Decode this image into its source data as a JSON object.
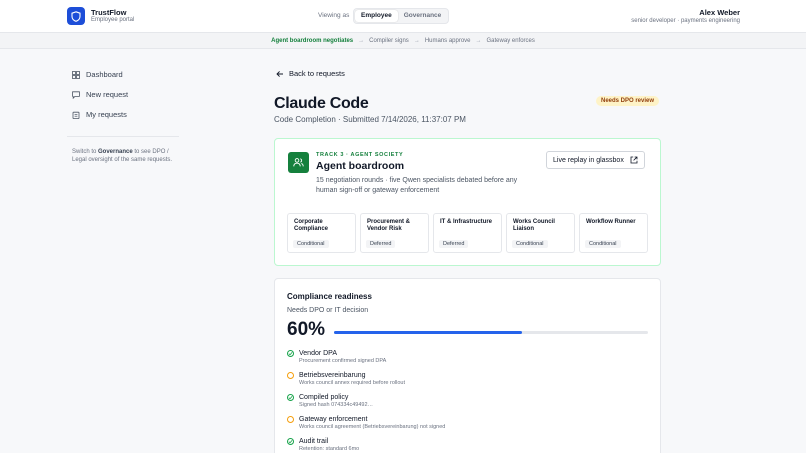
{
  "header": {
    "brand_name": "TrustFlow",
    "brand_sub": "Employee portal",
    "viewing_label": "Viewing as",
    "roles": [
      "Employee",
      "Governance"
    ],
    "user_name": "Alex Weber",
    "user_role": "senior developer · payments engineering"
  },
  "breadcrumb": {
    "steps": [
      "Agent boardroom negotiates",
      "Compiler signs",
      "Humans approve",
      "Gateway enforces"
    ]
  },
  "sidebar": {
    "items": [
      {
        "label": "Dashboard",
        "icon": "dashboard-icon"
      },
      {
        "label": "New request",
        "icon": "message-icon"
      },
      {
        "label": "My requests",
        "icon": "clipboard-icon"
      }
    ],
    "note_pre": "Switch to",
    "note_link": "Governance",
    "note_post": "to see DPO / Legal oversight of the same requests."
  },
  "main": {
    "back_label": "Back to requests",
    "title": "Claude Code",
    "subtitle": "Code Completion · Submitted 7/14/2026, 11:37:07 PM",
    "status_badge": "Needs DPO review",
    "track": {
      "eyebrow": "TRACK 3 · AGENT SOCIETY",
      "name": "Agent boardroom",
      "description": "15 negotiation rounds · five Qwen specialists debated before any human sign-off or gateway enforcement",
      "replay_label": "Live replay in glassbox",
      "reviewers": [
        {
          "name": "Corporate Compliance",
          "status": "Conditional"
        },
        {
          "name": "Procurement & Vendor Risk",
          "status": "Deferred"
        },
        {
          "name": "IT & Infrastructure",
          "status": "Deferred"
        },
        {
          "name": "Works Council Liaison",
          "status": "Conditional"
        },
        {
          "name": "Workflow Runner",
          "status": "Conditional"
        }
      ]
    },
    "compliance": {
      "title": "Compliance readiness",
      "subtitle": "Needs DPO or IT decision",
      "percent_label": "60%",
      "percent_value": 0.6,
      "items": [
        {
          "name": "Vendor DPA",
          "note": "Procurement confirmed signed DPA",
          "state": "done"
        },
        {
          "name": "Betriebsvereinbarung",
          "note": "Works council annex required before rollout",
          "state": "pending"
        },
        {
          "name": "Compiled policy",
          "note": "Signed hash 074334c49492…",
          "state": "done"
        },
        {
          "name": "Gateway enforcement",
          "note": "Works council agreement (Betriebsvereinbarung) not signed",
          "state": "pending"
        },
        {
          "name": "Audit trail",
          "note": "Retention: standard 6mo",
          "state": "done"
        }
      ]
    }
  },
  "colors": {
    "accent": "#1d4ed8",
    "success": "#15803d",
    "warning": "#f59e0b",
    "progress": "#2563eb"
  }
}
